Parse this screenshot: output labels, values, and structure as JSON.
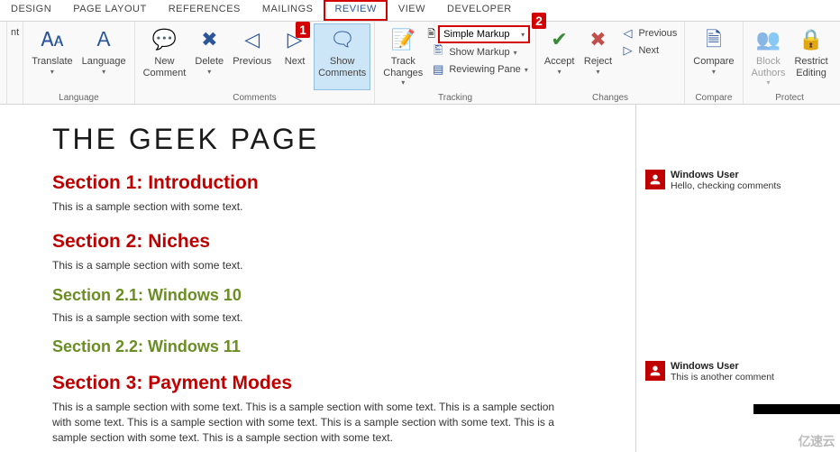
{
  "tabs": {
    "design": "DESIGN",
    "page_layout": "PAGE LAYOUT",
    "references": "REFERENCES",
    "mailings": "MAILINGS",
    "review": "REVIEW",
    "view": "VIEW",
    "developer": "DEVELOPER"
  },
  "callouts": {
    "one": "1",
    "two": "2"
  },
  "ribbon": {
    "language": {
      "translate": "Translate",
      "language": "Language",
      "group": "Language"
    },
    "comments": {
      "new_comment": "New\nComment",
      "delete": "Delete",
      "previous": "Previous",
      "next": "Next",
      "show_comments": "Show\nComments",
      "group": "Comments"
    },
    "tracking": {
      "track_changes": "Track\nChanges",
      "markup_select": "Simple Markup",
      "show_markup": "Show Markup",
      "reviewing_pane": "Reviewing Pane",
      "group": "Tracking"
    },
    "changes": {
      "accept": "Accept",
      "reject": "Reject",
      "previous": "Previous",
      "next": "Next",
      "group": "Changes"
    },
    "compare": {
      "compare": "Compare",
      "group": "Compare"
    },
    "protect": {
      "block_authors": "Block\nAuthors",
      "restrict_editing": "Restrict\nEditing",
      "group": "Protect"
    }
  },
  "doc": {
    "title": "THE GEEK PAGE",
    "s1_h": "Section 1: Introduction",
    "s1_t": "This is a sample section with some text.",
    "s2_h": "Section 2: Niches",
    "s2_t": "This is a sample section with some text.",
    "s21_h": "Section 2.1: Windows 10",
    "s21_t": "This is a sample section with some text.",
    "s22_h": "Section 2.2: Windows 11",
    "s3_h": "Section 3: Payment Modes",
    "s3_t": "This is a sample section with some text. This is a sample section with some text. This is a sample section with some text. This is a sample section with some text. This is a sample section with some text. This is a sample section with some text. This is a sample section with some text."
  },
  "comments": {
    "c1": {
      "author": "Windows User",
      "text": "Hello, checking comments"
    },
    "c2": {
      "author": "Windows User",
      "text": "This is another comment"
    }
  },
  "watermark": "亿速云"
}
